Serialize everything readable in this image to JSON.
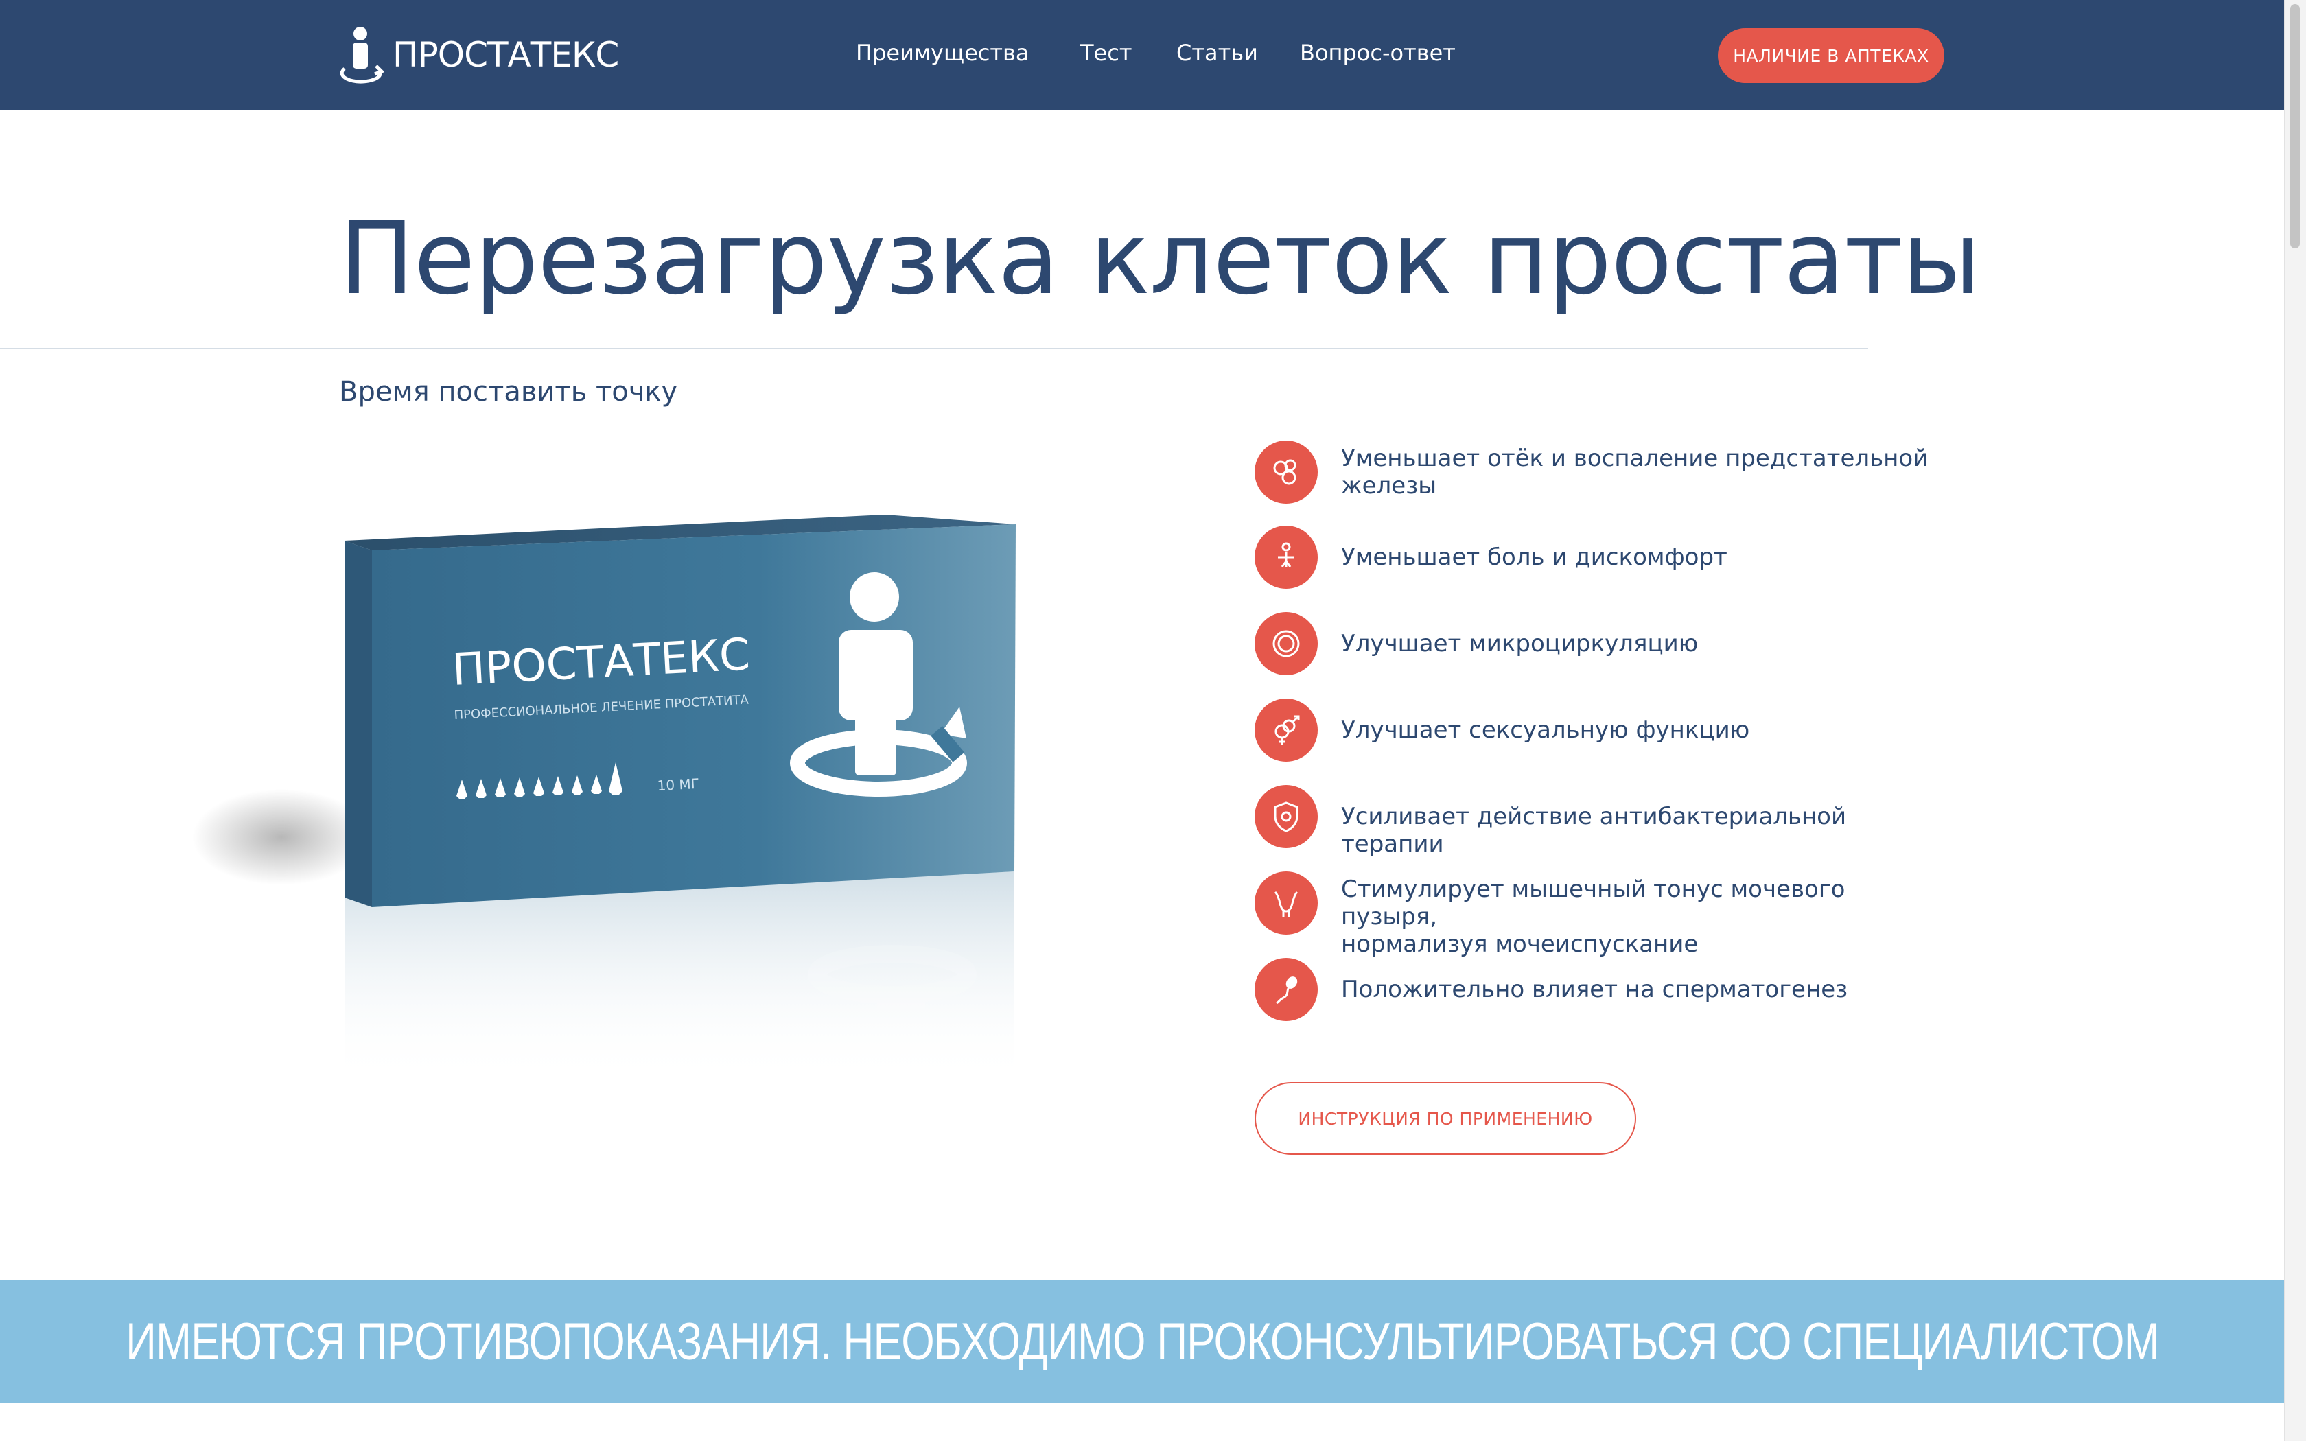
{
  "header": {
    "logo_text": "ПРОСТАТЕКС",
    "nav": [
      {
        "label": "Преимущества"
      },
      {
        "label": "Тест"
      },
      {
        "label": "Статьи"
      },
      {
        "label": "Вопрос-ответ"
      }
    ],
    "cta_label": "НАЛИЧИЕ В АПТЕКАХ"
  },
  "hero": {
    "title": "Перезагрузка клеток простаты",
    "subtitle": "Время поставить точку"
  },
  "product_box": {
    "brand": "ПРОСТАТЕКС",
    "tagline": "ПРОФЕССИОНАЛЬНОЕ ЛЕЧЕНИЕ ПРОСТАТИТА",
    "dose": "10 МГ"
  },
  "benefits": [
    {
      "icon": "cells-icon",
      "text": "Уменьшает отёк и воспаление предстательной\nжелезы"
    },
    {
      "icon": "pain-relief-icon",
      "text": "Уменьшает боль и дискомфорт"
    },
    {
      "icon": "circulation-icon",
      "text": "Улучшает микроциркуляцию"
    },
    {
      "icon": "gender-symbols-icon",
      "text": "Улучшает сексуальную функцию"
    },
    {
      "icon": "shield-icon",
      "text": "Усиливает действие антибактериальной терапии"
    },
    {
      "icon": "bladder-icon",
      "text": "Стимулирует мышечный тонус мочевого пузыря,\nнормализуя мочеиспускание"
    },
    {
      "icon": "sperm-icon",
      "text": "Положительно влияет на сперматогенез"
    }
  ],
  "instructions_label": "ИНСТРУКЦИЯ ПО ПРИМЕНЕНИЮ",
  "warning": "ИМЕЮТСЯ ПРОТИВОПОКАЗАНИЯ. НЕОБХОДИМО ПРОКОНСУЛЬТИРОВАТЬСЯ СО СПЕЦИАЛИСТОМ",
  "colors": {
    "header_bg": "#2d4870",
    "accent": "#e5574b",
    "text": "#2d4870",
    "warning_bg": "#86c0e0",
    "box_blue": "#3d6f91"
  }
}
